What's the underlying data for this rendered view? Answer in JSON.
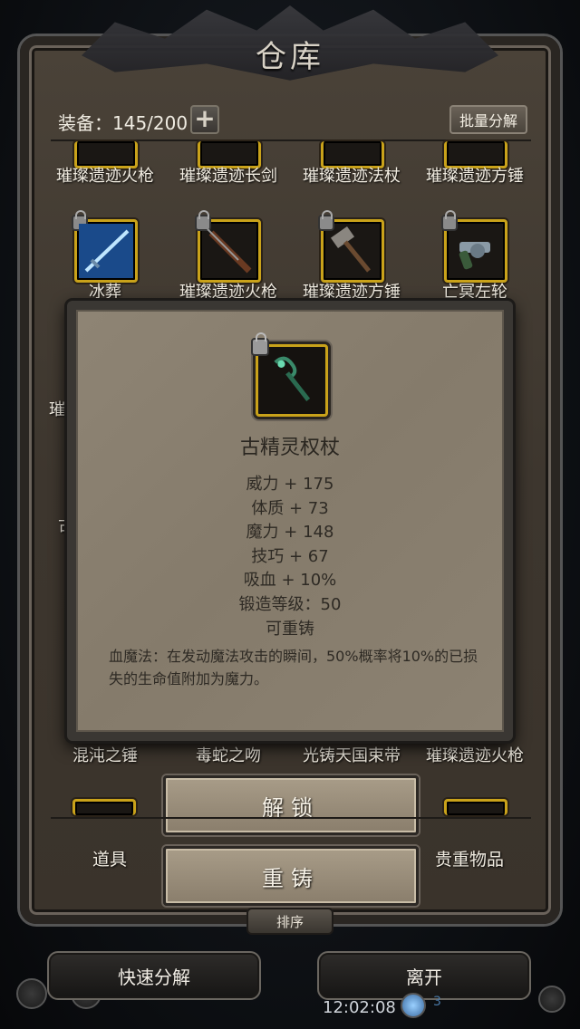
{
  "window": {
    "title": "仓库"
  },
  "header": {
    "equip_label": "装备：145/200",
    "plus_label": "+",
    "bulk_label": "批量分解"
  },
  "grid": {
    "row1": [
      "璀璨遗迹火枪",
      "璀璨遗迹长剑",
      "璀璨遗迹法杖",
      "璀璨遗迹方锤"
    ],
    "row2": [
      "冰葬",
      "璀璨遗迹火枪",
      "璀璨遗迹方锤",
      "亡冥左轮"
    ],
    "row3_partial": [
      "璀璨",
      "古"
    ],
    "row6": [
      "混沌之锤",
      "毒蛇之吻",
      "光铸天国束带",
      "璀璨遗迹火枪"
    ]
  },
  "popup": {
    "name": "古精灵权杖",
    "stats": [
      "威力 + 175",
      "体质 + 73",
      "魔力 + 148",
      "技巧 + 67",
      "吸血 + 10%",
      "锻造等级：50",
      "可重铸"
    ],
    "desc": "血魔法：在发动魔法攻击的瞬间，50%概率将10%的已损失的生命值附加为魔力。",
    "accent": "#c9a21a"
  },
  "actions": {
    "unlock": "解锁",
    "reforge": "重铸"
  },
  "tabs": {
    "left": "道具",
    "right": "贵重物品",
    "sort": "排序"
  },
  "footer": {
    "quick_decompose": "快速分解",
    "leave": "离开",
    "clock": "12:02:08",
    "status_count": "3"
  }
}
